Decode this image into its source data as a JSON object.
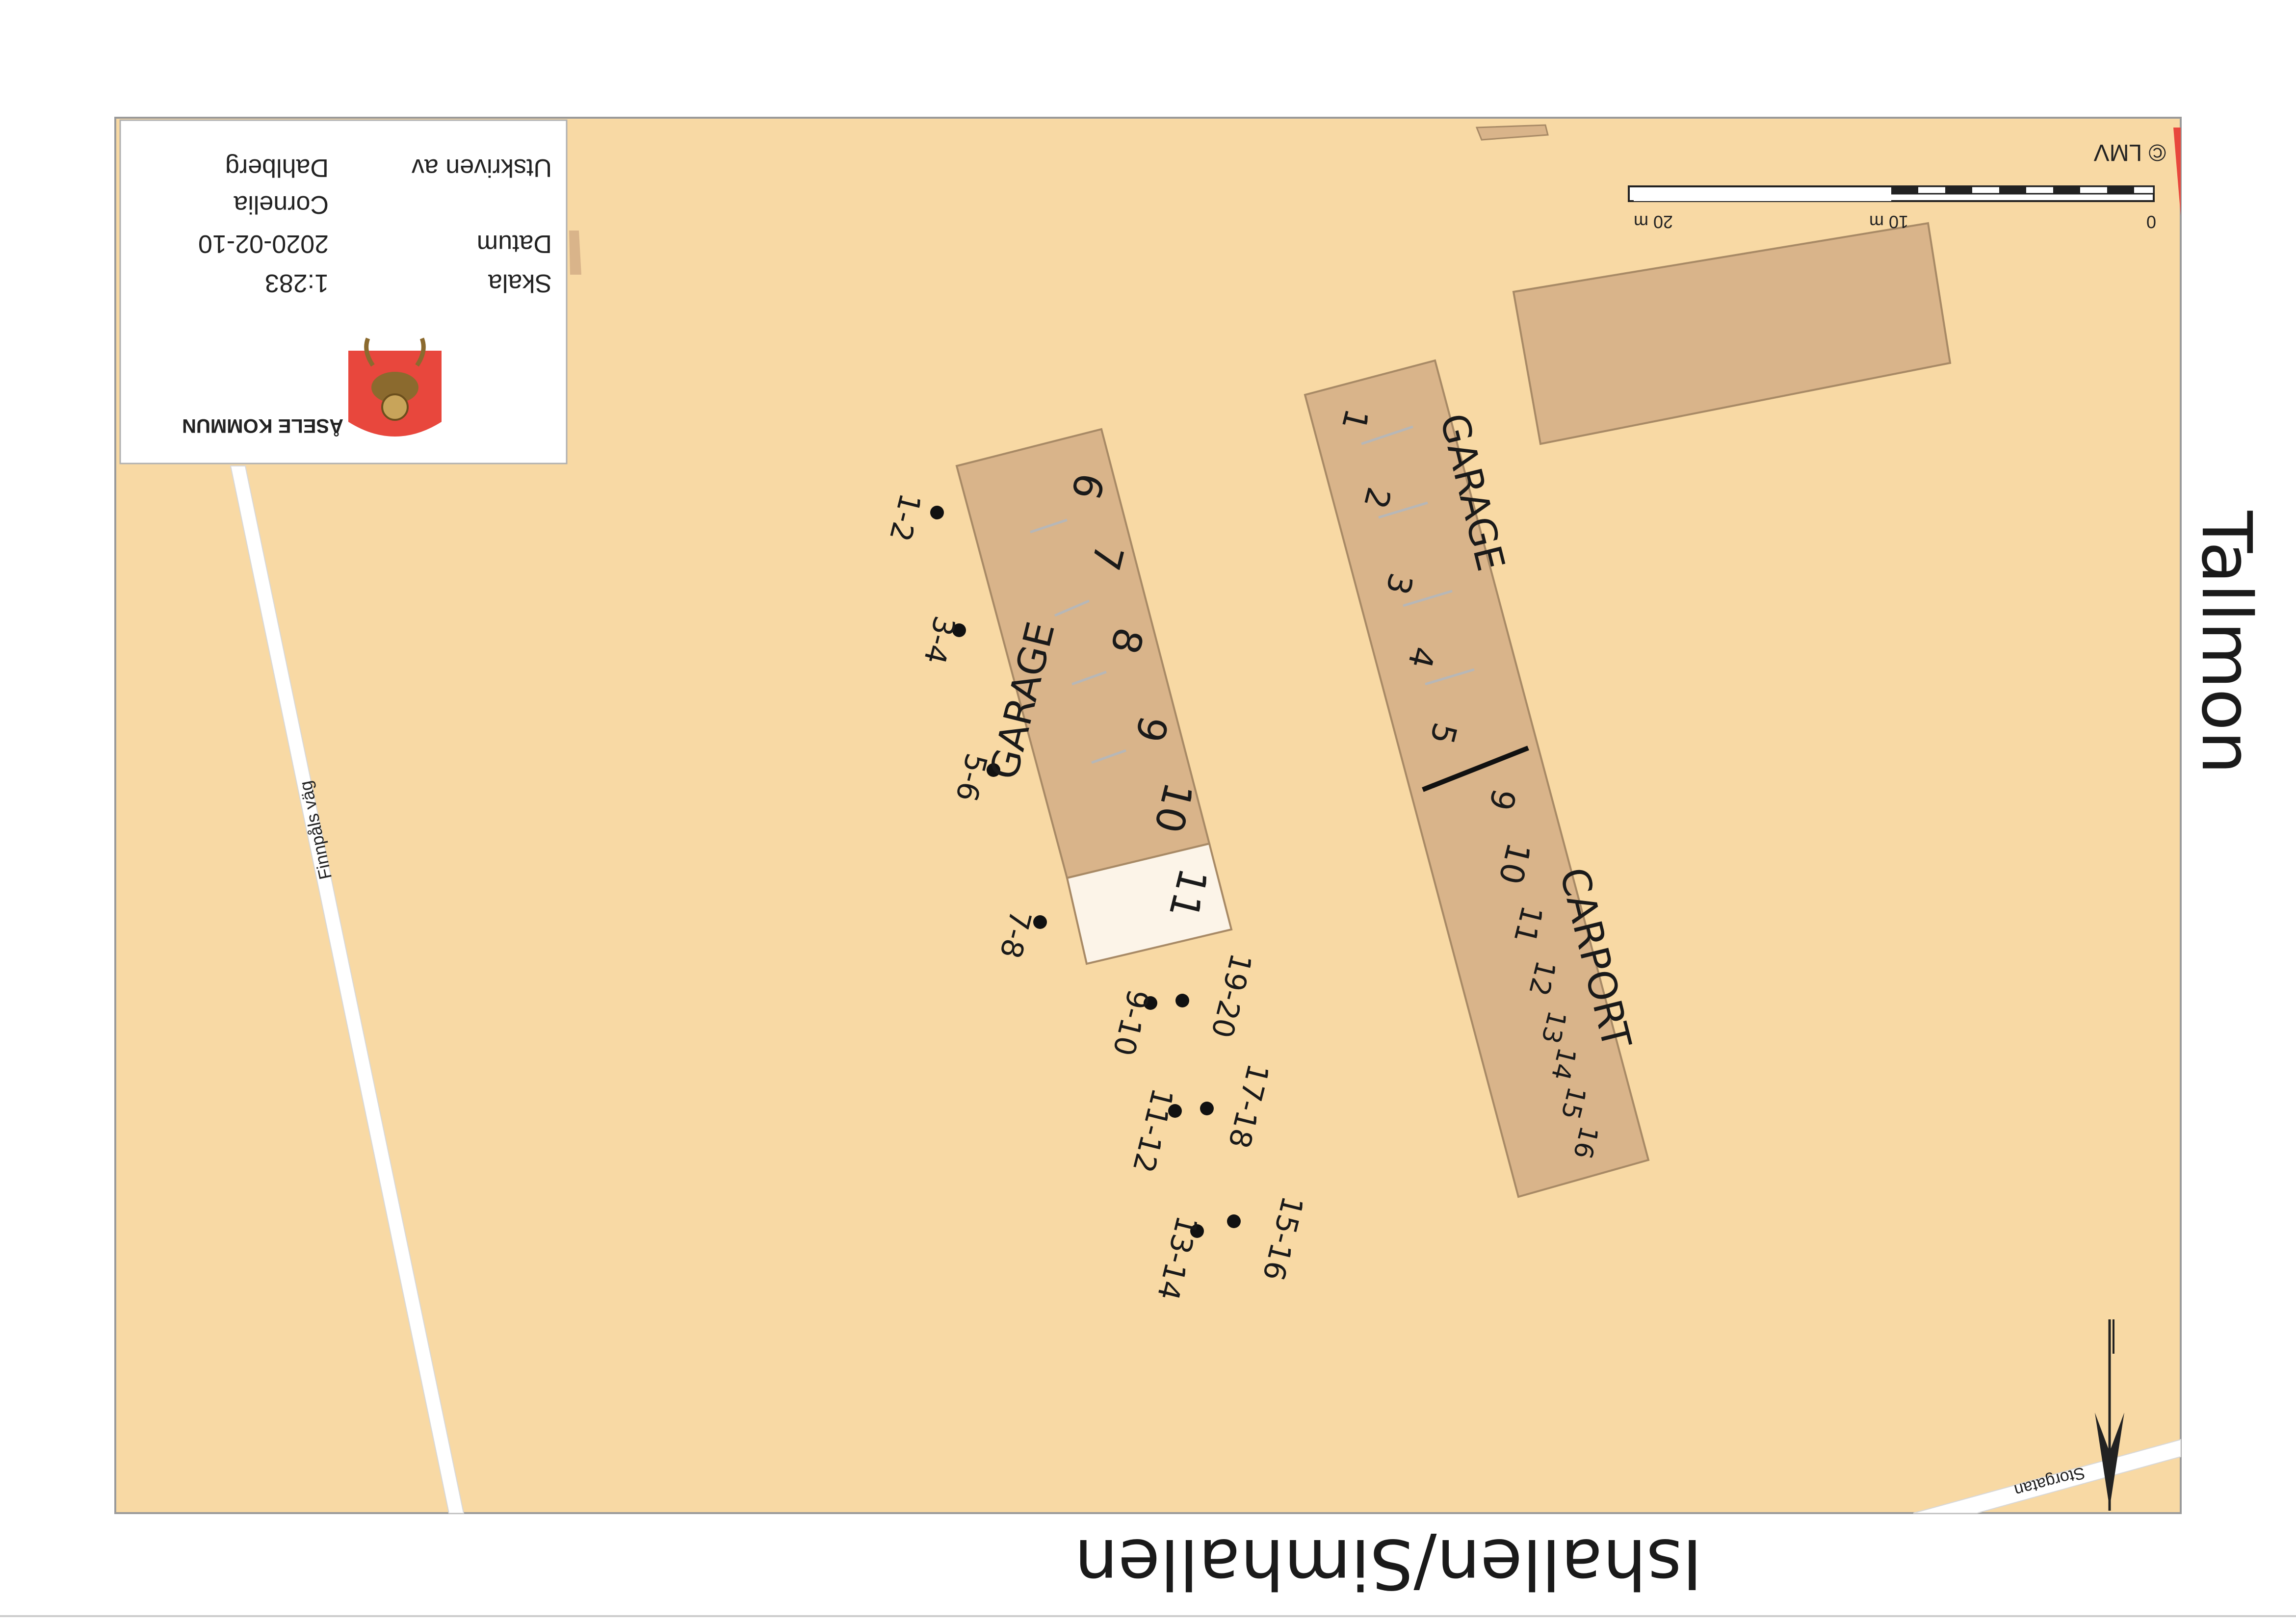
{
  "titleblock": {
    "org": "ÅSELE KOMMUN",
    "printed_by_label": "Utskriven av",
    "printed_by_value_1": "Cornelia",
    "printed_by_value_2": "Dahlberg",
    "date_label": "Datum",
    "date_value": "2020-02-10",
    "scale_label": "Skala",
    "scale_value": "1:283"
  },
  "copyright": "© LMV",
  "scalebar": {
    "label_0": "0",
    "label_10": "10 m",
    "label_20": "20 m"
  },
  "roads": {
    "finnpals": "Finnpåls väg",
    "storgatan": "Storgatan"
  },
  "place_labels": {
    "tallmon": "Tallmon",
    "ishallen": "Ishallen/Simhallen"
  },
  "left_garage": {
    "title": "GARAGE",
    "bays": [
      "6",
      "7",
      "8",
      "9",
      "10",
      "11"
    ]
  },
  "right_building": {
    "garage_title": "GARAGE",
    "carport_title": "CARPORT",
    "garage_bays": [
      "1",
      "2",
      "3",
      "4",
      "5"
    ],
    "carport_bays": [
      "9",
      "10",
      "11",
      "12",
      "13",
      "14",
      "15",
      "16"
    ]
  },
  "parking_spots": [
    {
      "label": "1-2"
    },
    {
      "label": "3-4"
    },
    {
      "label": "5-6"
    },
    {
      "label": "7-8"
    },
    {
      "label": "9-10"
    },
    {
      "label": "19-20"
    },
    {
      "label": "11-12"
    },
    {
      "label": "17-18"
    },
    {
      "label": "13-14"
    },
    {
      "label": "15-16"
    }
  ],
  "colors": {
    "land": "#F8D9A4",
    "building": "#D9B48A",
    "road": "#FFFFFF",
    "accent_red": "#E8473D"
  }
}
